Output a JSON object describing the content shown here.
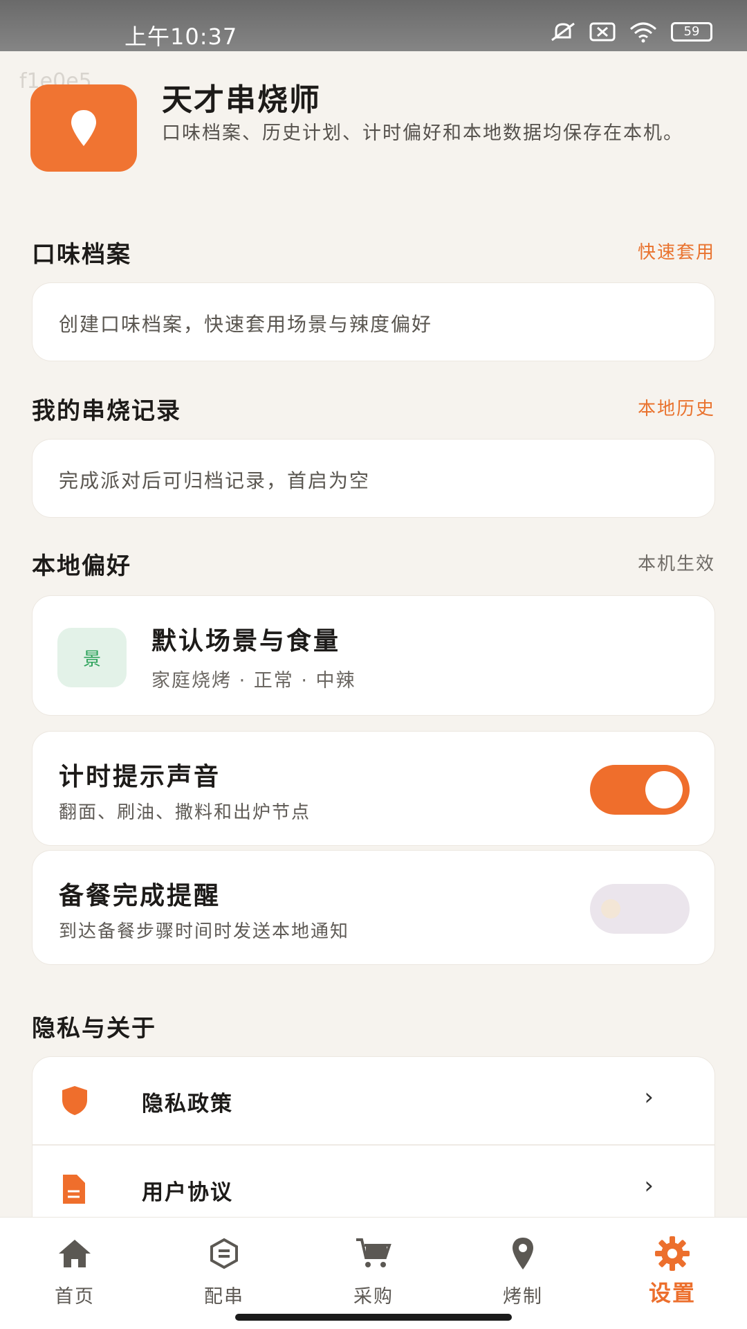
{
  "status_bar": {
    "time": "上午10:37",
    "battery": "59"
  },
  "watermark": "f1e0e5",
  "app": {
    "name": "天才串烧师",
    "description": "口味档案、历史计划、计时偏好和本地数据均保存在本机。"
  },
  "taste_profile": {
    "title": "口味档案",
    "action": "快速套用",
    "card_text": "创建口味档案，快速套用场景与辣度偏好"
  },
  "records": {
    "title": "我的串烧记录",
    "action": "本地历史",
    "card_text": "完成派对后可归档记录，首启为空"
  },
  "local_prefs": {
    "title": "本地偏好",
    "action": "本机生效",
    "default_scene": {
      "icon_text": "景",
      "title": "默认场景与食量",
      "subtitle": "家庭烧烤 · 正常 · 中辣"
    },
    "timer_sound": {
      "title": "计时提示声音",
      "subtitle": "翻面、刷油、撒料和出炉节点",
      "enabled": true
    },
    "prep_reminder": {
      "title": "备餐完成提醒",
      "subtitle": "到达备餐步骤时间时发送本地通知",
      "enabled": false
    }
  },
  "privacy": {
    "title": "隐私与关于",
    "items": [
      {
        "label": "隐私政策",
        "icon": "shield-icon"
      },
      {
        "label": "用户协议",
        "icon": "document-icon"
      }
    ]
  },
  "tab_bar": {
    "tabs": [
      {
        "label": "首页",
        "icon": "home-icon"
      },
      {
        "label": "配串",
        "icon": "skewer-icon"
      },
      {
        "label": "采购",
        "icon": "cart-icon"
      },
      {
        "label": "烤制",
        "icon": "location-pin-icon"
      },
      {
        "label": "设置",
        "icon": "gear-icon",
        "active": true
      }
    ]
  },
  "colors": {
    "accent": "#EF6E2C",
    "background": "#F6F3EE",
    "green_tag": "#2DA35B"
  }
}
